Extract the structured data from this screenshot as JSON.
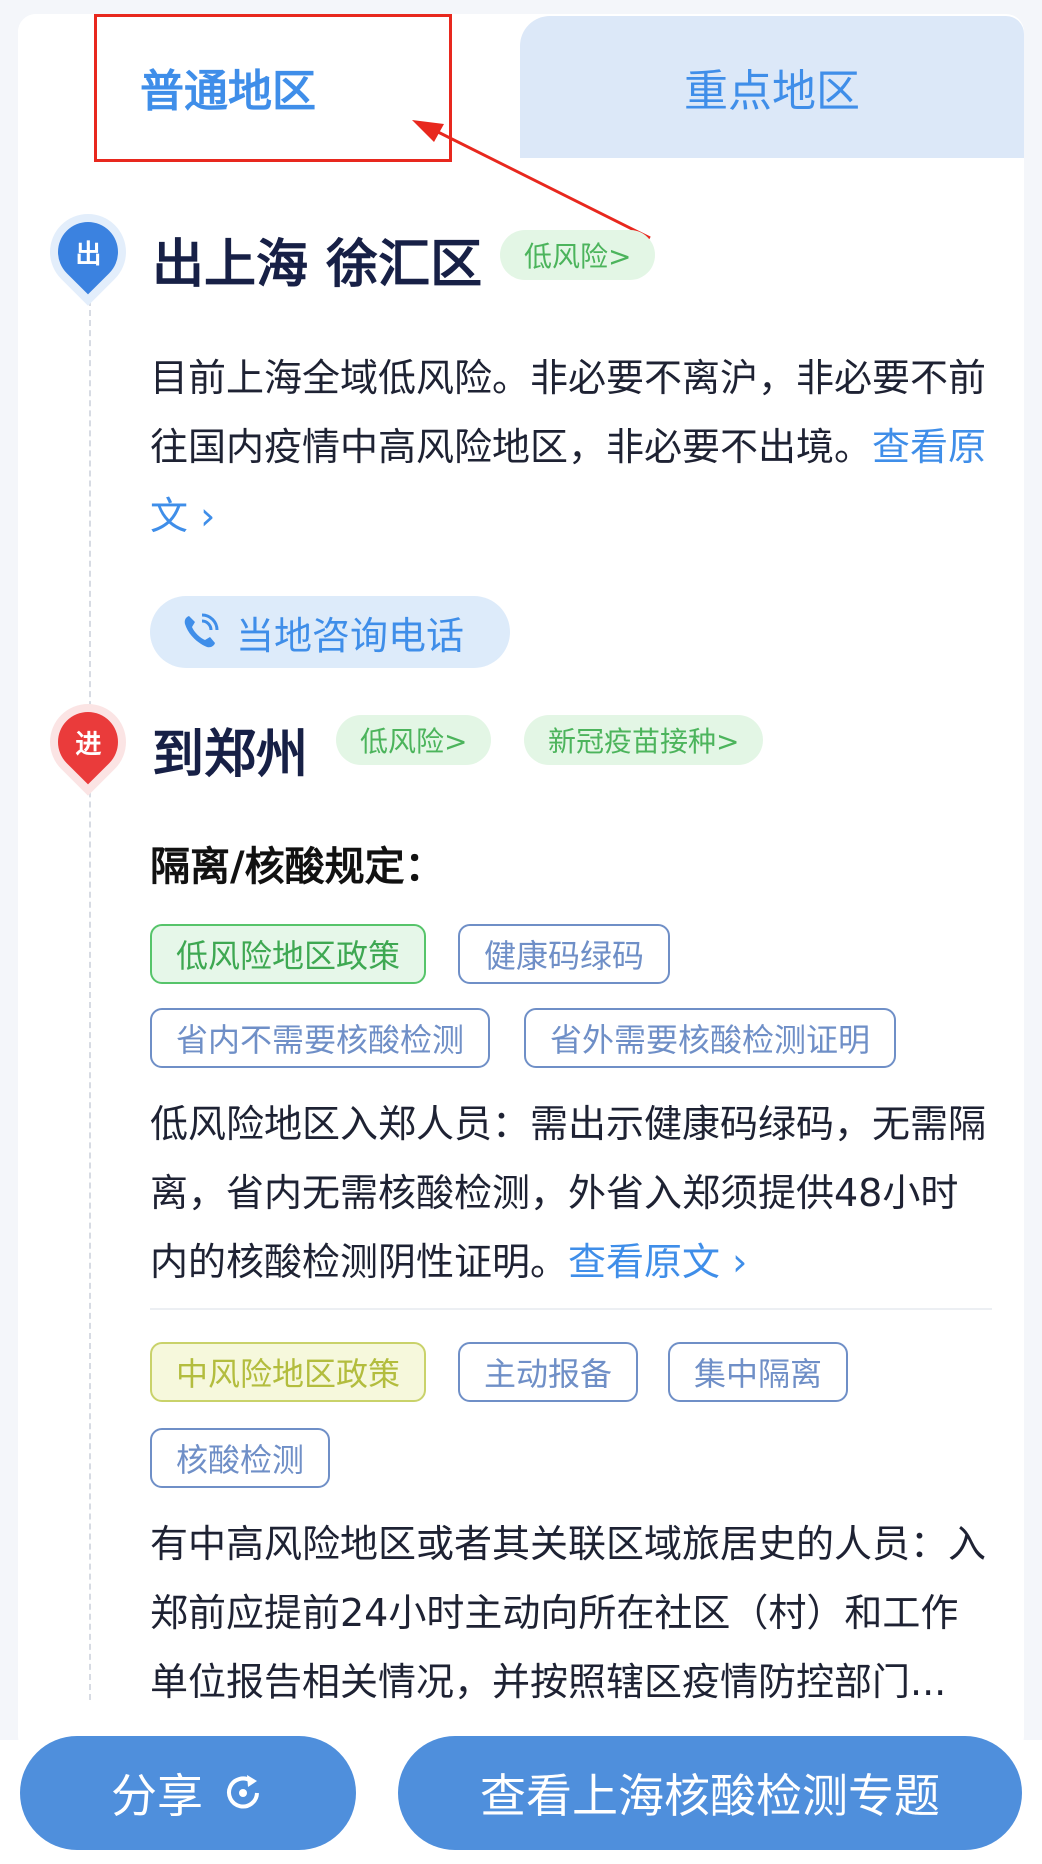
{
  "tabs": {
    "normal": "普通地区",
    "key": "重点地区"
  },
  "departure": {
    "marker": "出",
    "title": "出上海 徐汇区",
    "risk_pill": "低风险>",
    "text": "目前上海全域低风险。非必要不离沪，非必要不前往国内疫情中高风险地区，非必要不出境。",
    "link": "查看原文 ›",
    "phone_button": "当地咨询电话",
    "icon": "phone-icon"
  },
  "arrival": {
    "marker": "进",
    "title": "到郑州",
    "risk_pill": "低风险>",
    "vaccine_pill": "新冠疫苗接种>",
    "subhead": "隔离/核酸规定：",
    "low_policy": {
      "tags": [
        "低风险地区政策",
        "健康码绿码",
        "省内不需要核酸检测",
        "省外需要核酸检测证明"
      ],
      "text": "低风险地区入郑人员：需出示健康码绿码，无需隔离，省内无需核酸检测，外省入郑须提供48小时内的核酸检测阴性证明。",
      "link": "查看原文 ›"
    },
    "mid_policy": {
      "tags": [
        "中风险地区政策",
        "主动报备",
        "集中隔离",
        "核酸检测"
      ],
      "text": "有中高风险地区或者其关联区域旅居史的人员：入郑前应提前24小时主动向所在社区（村）和工作单位报告相关情况，并按照辖区疫情防控部门..."
    }
  },
  "footer": {
    "share": "分享",
    "share_icon": "refresh-icon",
    "topic": "查看上海核酸检测专题"
  },
  "colors": {
    "accent": "#3f8ee9",
    "button": "#4f8fdc",
    "green": "#4cb45c",
    "red_annotation": "#e8281e"
  }
}
